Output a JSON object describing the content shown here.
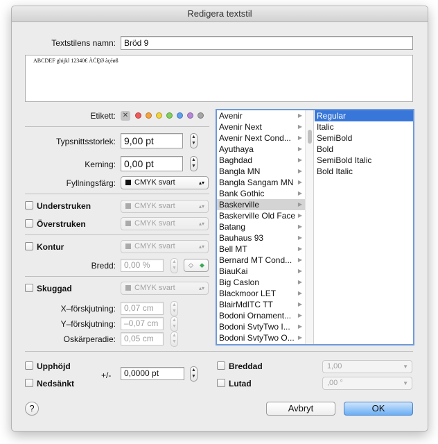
{
  "window": {
    "title": "Redigera textstil"
  },
  "style_name": {
    "label": "Textstilens namn:",
    "value": "Bröd 9"
  },
  "preview": {
    "text": "ABCDEF ghijkl 12340€ ÀĆĘØ àçéøß"
  },
  "etikett": {
    "label": "Etikett:",
    "none_symbol": "✕",
    "colors": [
      "#f25a5a",
      "#f7a33d",
      "#f2d33a",
      "#7fd05c",
      "#5e9ff0",
      "#b886d9",
      "#a6a6a6"
    ]
  },
  "font_size": {
    "label": "Typsnittsstorlek:",
    "value": "9,00 pt"
  },
  "kerning": {
    "label": "Kerning:",
    "value": "0,00 pt"
  },
  "fill_color": {
    "label": "Fyllningsfärg:",
    "value": "CMYK svart"
  },
  "underline": {
    "label": "Understruken",
    "color": "CMYK svart"
  },
  "strikethrough": {
    "label": "Överstruken",
    "color": "CMYK svart"
  },
  "outline": {
    "label": "Kontur",
    "color": "CMYK svart",
    "width_label": "Bredd:",
    "width_value": "0,00 %"
  },
  "shadow": {
    "label": "Skuggad",
    "color": "CMYK svart",
    "x_label": "X–förskjutning:",
    "x_value": "0,07 cm",
    "y_label": "Y–förskjutning:",
    "y_value": "–0,07 cm",
    "blur_label": "Oskärperadie:",
    "blur_value": "0,05 cm"
  },
  "fonts": [
    "Avenir",
    "Avenir Next",
    "Avenir Next Cond...",
    "Ayuthaya",
    "Baghdad",
    "Bangla MN",
    "Bangla Sangam MN",
    "Bank Gothic",
    "Baskerville",
    "Baskerville Old Face",
    "Batang",
    "Bauhaus 93",
    "Bell MT",
    "Bernard MT Cond...",
    "BiauKai",
    "Big Caslon",
    "Blackmoor LET",
    "BlairMdITC TT",
    "Bodoni Ornament...",
    "Bodoni SvtyTwo I...",
    "Bodoni SvtyTwo O..."
  ],
  "selected_font": "Baskerville",
  "styles": [
    "Regular",
    "Italic",
    "SemiBold",
    "Bold",
    "SemiBold Italic",
    "Bold Italic"
  ],
  "selected_style": "Regular",
  "superscript": {
    "label": "Upphöjd"
  },
  "subscript": {
    "label": "Nedsänkt"
  },
  "baseline": {
    "label": "+/-",
    "value": "0,0000 pt"
  },
  "widened": {
    "label": "Breddad",
    "value": "1,00"
  },
  "slanted": {
    "label": "Lutad",
    "value": ",00 °"
  },
  "help": {
    "symbol": "?"
  },
  "buttons": {
    "cancel": "Avbryt",
    "ok": "OK"
  }
}
